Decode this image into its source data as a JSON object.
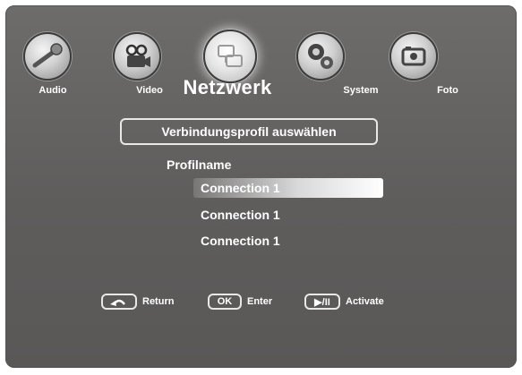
{
  "categories": [
    {
      "label": "Audio",
      "icon": "microphone-icon"
    },
    {
      "label": "Video",
      "icon": "projector-icon"
    },
    {
      "label": "Netzwerk",
      "icon": "network-icon",
      "active": true
    },
    {
      "label": "System",
      "icon": "gears-icon"
    },
    {
      "label": "Foto",
      "icon": "photo-icon"
    }
  ],
  "menu": {
    "header": "Verbindungsprofil auswählen",
    "column_label": "Profilname",
    "profiles": [
      "Connection 1",
      "Connection 1",
      "Connection 1"
    ],
    "selected_index": 0
  },
  "hints": {
    "return_label": "Return",
    "ok_key": "OK",
    "enter_label": "Enter",
    "play_key": "▶/II",
    "activate_label": "Activate"
  }
}
